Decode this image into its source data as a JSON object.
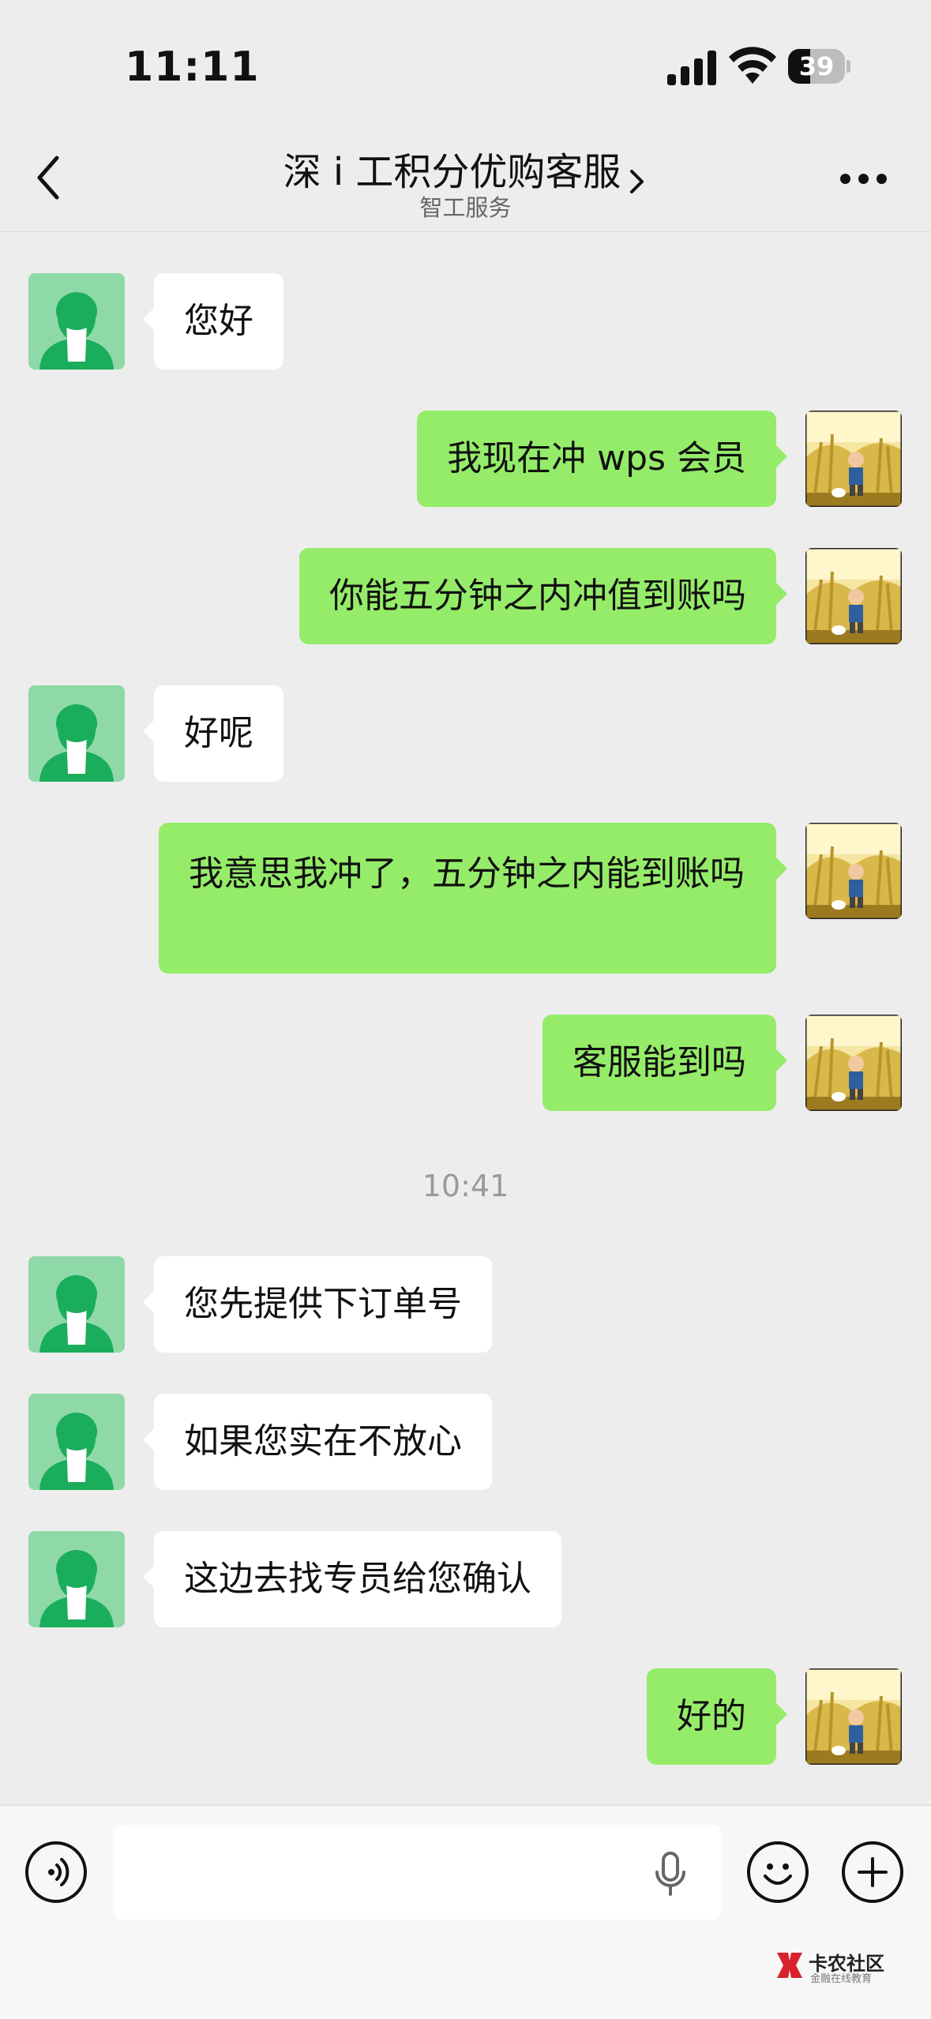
{
  "status_bar": {
    "time": "11:11",
    "battery": "39",
    "battery_level": 0.39
  },
  "header": {
    "title": "深 i 工积分优购客服",
    "subtitle": "智工服务"
  },
  "messages": [
    {
      "side": "in",
      "text": "您好"
    },
    {
      "side": "out",
      "text": "我现在冲 wps 会员"
    },
    {
      "side": "out",
      "text": "你能五分钟之内冲值到账吗"
    },
    {
      "side": "in",
      "text": "好呢"
    },
    {
      "side": "out",
      "text": "我意思我冲了，五分钟之内能到账吗"
    },
    {
      "side": "out",
      "text": "客服能到吗"
    },
    {
      "side": "in",
      "text": "您先提供下订单号"
    },
    {
      "side": "in",
      "text": "如果您实在不放心"
    },
    {
      "side": "in",
      "text": "这边去找专员给您确认"
    },
    {
      "side": "out",
      "text": "好的"
    }
  ],
  "timestamp": "10:41",
  "input": {
    "value": "",
    "placeholder": ""
  },
  "icons": {
    "back": "chevron-left-icon",
    "more": "ellipsis-icon",
    "voice": "voice-wave-icon",
    "mic": "microphone-icon",
    "emoji": "smiley-icon",
    "add": "plus-icon"
  },
  "watermark": {
    "title": "卡农社区",
    "subtitle": "金融在线教育"
  },
  "colors": {
    "background": "#ededed",
    "outgoing_bubble": "#95ec69",
    "incoming_bubble": "#ffffff",
    "agent_avatar": "#1aad5b"
  }
}
